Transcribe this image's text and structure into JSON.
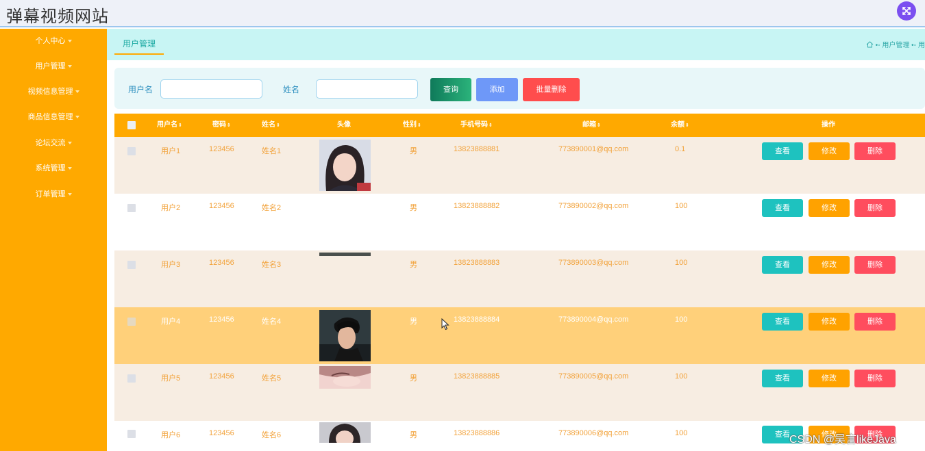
{
  "app": {
    "title": "弹幕视频网站",
    "fullscreen_icon": "expand-icon"
  },
  "sidebar": {
    "items": [
      {
        "label": "个人中心"
      },
      {
        "label": "用户管理"
      },
      {
        "label": "视频信息管理"
      },
      {
        "label": "商品信息管理"
      },
      {
        "label": "论坛交流"
      },
      {
        "label": "系统管理"
      },
      {
        "label": "订单管理"
      }
    ]
  },
  "tabs": {
    "active": "用户管理"
  },
  "breadcrumb": {
    "home_icon": "home-icon",
    "sep1": "•◦",
    "current": "用户管理",
    "sep2": "•◦",
    "trailing": "用"
  },
  "search": {
    "username_label": "用户名",
    "name_label": "姓名",
    "username_value": "",
    "name_value": "",
    "query_btn": "查询",
    "add_btn": "添加",
    "batch_delete_btn": "批量删除"
  },
  "table": {
    "columns": {
      "username": "用户名",
      "password": "密码",
      "name": "姓名",
      "avatar": "头像",
      "gender": "性别",
      "phone": "手机号码",
      "email": "邮箱",
      "balance": "余额",
      "actions": "操作"
    },
    "sort_symbol": "⇕",
    "rows": [
      {
        "username": "用户1",
        "password": "123456",
        "name": "姓名1",
        "gender": "男",
        "phone": "13823888881",
        "email": "773890001@qq.com",
        "balance": "0.1"
      },
      {
        "username": "用户2",
        "password": "123456",
        "name": "姓名2",
        "gender": "男",
        "phone": "13823888882",
        "email": "773890002@qq.com",
        "balance": "100"
      },
      {
        "username": "用户3",
        "password": "123456",
        "name": "姓名3",
        "gender": "男",
        "phone": "13823888883",
        "email": "773890003@qq.com",
        "balance": "100"
      },
      {
        "username": "用户4",
        "password": "123456",
        "name": "姓名4",
        "gender": "男",
        "phone": "13823888884",
        "email": "773890004@qq.com",
        "balance": "100"
      },
      {
        "username": "用户5",
        "password": "123456",
        "name": "姓名5",
        "gender": "男",
        "phone": "13823888885",
        "email": "773890005@qq.com",
        "balance": "100"
      },
      {
        "username": "用户6",
        "password": "123456",
        "name": "姓名6",
        "gender": "男",
        "phone": "13823888886",
        "email": "773890006@qq.com",
        "balance": "100"
      }
    ],
    "actions": {
      "view": "查看",
      "edit": "修改",
      "delete": "删除"
    }
  },
  "watermark": "CSDN @吴言likeJava",
  "colors": {
    "accent": "#ffa900",
    "tabbar": "#c8f5f4",
    "row_even": "#f7ede2",
    "row_hover": "#ffd07a",
    "view_btn": "#1ec2bf",
    "edit_btn": "#ffa200",
    "delete_btn": "#ff4d5e",
    "query_btn": "#1b8a6b",
    "add_btn": "#6e98f8",
    "batch_delete_btn": "#ff4d4d"
  }
}
